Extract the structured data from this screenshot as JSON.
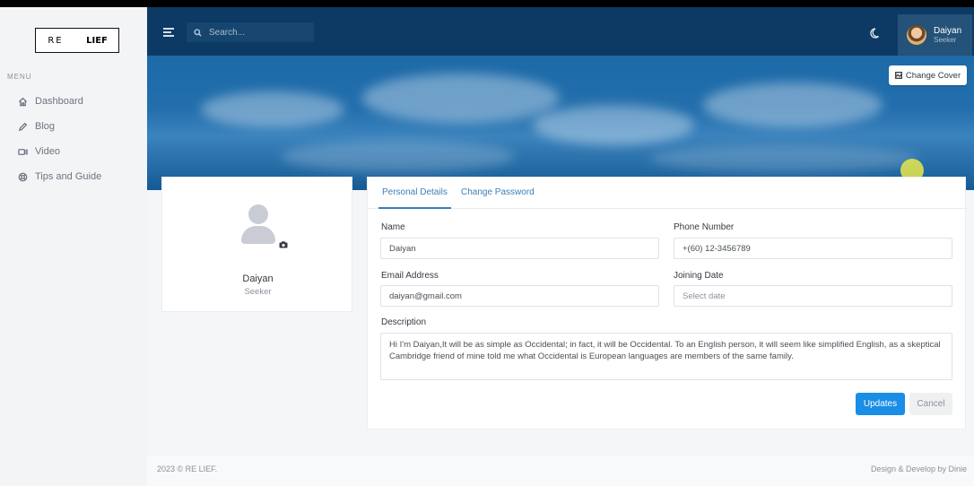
{
  "logo": {
    "part1": "RE",
    "part2": "LIEF"
  },
  "sidebar": {
    "menu_title": "MENU",
    "items": [
      {
        "label": "Dashboard",
        "icon": "home-icon"
      },
      {
        "label": "Blog",
        "icon": "pencil-icon"
      },
      {
        "label": "Video",
        "icon": "video-icon"
      },
      {
        "label": "Tips and Guide",
        "icon": "lifebuoy-icon"
      }
    ]
  },
  "header": {
    "search_placeholder": "Search...",
    "user": {
      "name": "Daiyan",
      "role": "Seeker"
    }
  },
  "cover": {
    "change_cover_label": "Change Cover"
  },
  "profile": {
    "name": "Daiyan",
    "role": "Seeker"
  },
  "tabs": [
    {
      "label": "Personal Details"
    },
    {
      "label": "Change Password"
    }
  ],
  "form": {
    "name": {
      "label": "Name",
      "value": "Daiyan"
    },
    "phone": {
      "label": "Phone Number",
      "value": "+(60) 12-3456789"
    },
    "email": {
      "label": "Email Address",
      "value": "daiyan@gmail.com"
    },
    "joining_date": {
      "label": "Joining Date",
      "placeholder": "Select date"
    },
    "description": {
      "label": "Description",
      "value": "Hi I'm Daiyan,It will be as simple as Occidental; in fact, it will be Occidental. To an English person, it will seem like simplified English, as a skeptical Cambridge friend of mine told me what Occidental is European languages are members of the same family."
    },
    "update_label": "Updates",
    "cancel_label": "Cancel"
  },
  "footer": {
    "copyright": "2023 © RE LIEF.",
    "credit": "Design & Develop by Dinie"
  },
  "colors": {
    "header_bg": "#0d3a64",
    "accent": "#1a8de6",
    "tab_active": "#3c7fb8"
  }
}
